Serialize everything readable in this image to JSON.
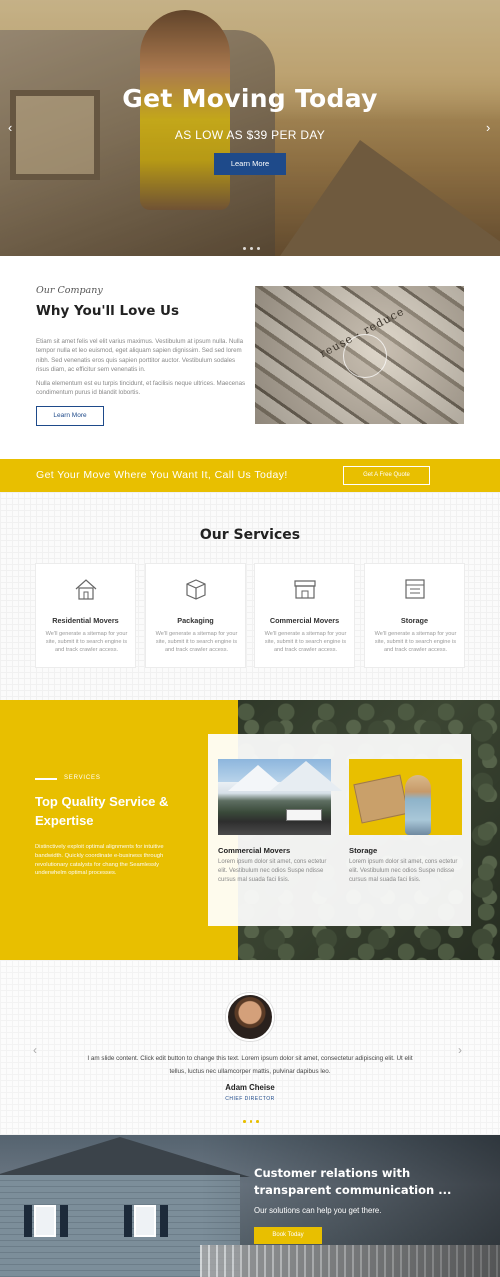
{
  "hero": {
    "title": "Get Moving Today",
    "subtitle": "AS LOW AS $39 PER DAY",
    "button_label": "Learn More",
    "prev_arrow": "‹",
    "next_arrow": "›"
  },
  "about": {
    "eyebrow": "Our Company",
    "title": "Why You'll Love Us",
    "paragraph1": "Etiam sit amet felis vel elit varius maximus. Vestibulum at ipsum nulla. Nulla tempor nulla et leo euismod, eget aliquam sapien dignissim. Sed sed lorem nibh. Sed venenatis eros quis sapien porttitor auctor. Vestibulum sodales risus diam, ac efficitur sem venenatis in.",
    "paragraph2": "Nulla elementum est eu turpis tincidunt, et facilisis neque ultrices. Maecenas condimentum purus id blandit lobortis.",
    "button_label": "Learn More",
    "image_text": "reuse · reduce"
  },
  "cta": {
    "text": "Get Your Move Where You Want It, Call Us Today!",
    "button_label": "Get A Free Quote"
  },
  "services": {
    "title": "Our Services",
    "items": [
      {
        "name": "Residential Movers",
        "icon": "house-icon",
        "desc": "We'll generate a sitemap for your site, submit it to search engine is and track crawler access."
      },
      {
        "name": "Packaging",
        "icon": "box-icon",
        "desc": "We'll generate a sitemap for your site, submit it to search engine is and track crawler access."
      },
      {
        "name": "Commercial Movers",
        "icon": "store-icon",
        "desc": "We'll generate a sitemap for your site, submit it to search engine is and track crawler access."
      },
      {
        "name": "Storage",
        "icon": "storage-icon",
        "desc": "We'll generate a sitemap for your site, submit it to search engine is and track crawler access."
      }
    ]
  },
  "quality": {
    "eyebrow": "SERVICES",
    "title": "Top Quality Service & Expertise",
    "desc": "Distinctively exploit optimal alignments for intuitive bandwidth. Quickly coordinate e-business through revolutionary catalysts for chang the Seamlessly underwhelm optimal processes.",
    "cards": [
      {
        "name": "Commercial Movers",
        "desc": "Lorem ipsum dolor sit amet, cons ectetur elit. Vestibulum nec odios Suspe ndisse cursus mal suada faci lisis."
      },
      {
        "name": "Storage",
        "desc": "Lorem ipsum dolor sit amet, cons ectetur elit. Vestibulum nec odios Suspe ndisse cursus mal suada faci lisis."
      }
    ]
  },
  "testimonial": {
    "text": "I am slide content. Click edit button to change this text. Lorem ipsum dolor sit amet, consectetur adipiscing elit. Ut elit tellus, luctus nec ullamcorper mattis, pulvinar dapibus leo.",
    "name": "Adam Cheise",
    "role": "CHIEF DIRECTOR",
    "prev_arrow": "‹",
    "next_arrow": "›"
  },
  "bottom": {
    "title": "Customer relations with transparent communication ...",
    "subtitle": "Our solutions can help you get there.",
    "button_label": "Book Today"
  },
  "colors": {
    "accent_yellow": "#e8bf00",
    "brand_blue": "#1e4a8a"
  }
}
